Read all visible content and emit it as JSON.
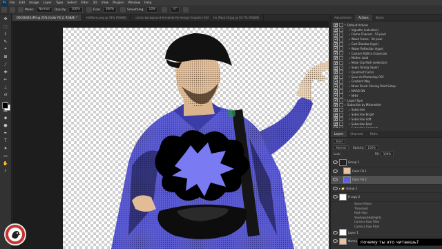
{
  "app": {
    "logo": "Ps"
  },
  "menu": [
    "File",
    "Edit",
    "Image",
    "Layer",
    "Type",
    "Select",
    "Filter",
    "3D",
    "View",
    "Plugins",
    "Window",
    "Help"
  ],
  "options_bar": {
    "mode_label": "Mode:",
    "mode_value": "Normal",
    "opacity_label": "Opacity:",
    "opacity_value": "100%",
    "flow_label": "Flow:",
    "flow_value": "100%",
    "smoothing_label": "Smoothing:",
    "smoothing_value": "10%",
    "angle_value": "0°"
  },
  "document_tabs": [
    {
      "label": "DSC06420.JPG @ 25% (Color Fill 2, RGB/8) *",
      "active": true
    },
    {
      "label": "Halftone.png @ 33% (RGB/8)",
      "active": false
    },
    {
      "label": "comic-background-template-for-design-Graphics-16477431-1.jpg @ 13,1%",
      "active": false
    },
    {
      "label": "lm_Mock.tif.jpg @ 16,7% (RGB/8)",
      "active": false
    }
  ],
  "toolbar_icons": [
    "move-icon",
    "marquee-icon",
    "lasso-icon",
    "quick-select-icon",
    "crop-icon",
    "frame-icon",
    "eyedropper-icon",
    "healing-icon",
    "brush-icon",
    "stamp-icon",
    "history-brush-icon",
    "eraser-icon",
    "gradient-icon",
    "blur-icon",
    "dodge-icon",
    "pen-icon",
    "type-icon",
    "path-select-icon",
    "shape-icon",
    "hand-icon",
    "zoom-icon"
  ],
  "colors": {
    "foreground": "#000000",
    "background": "#ffffff",
    "shirt": "#5c5cd6",
    "accent": "#31a8ff",
    "badge": "#c8322d"
  },
  "actions_panel": {
    "tabs": [
      "Adjustments",
      "Actions",
      "Styles"
    ],
    "items": [
      {
        "label": "Default Actions",
        "level": 0
      },
      {
        "label": "Vignette (selection)",
        "level": 1
      },
      {
        "label": "Frame Channel - 50 pixel",
        "level": 1
      },
      {
        "label": "Wood Frame - 50 pixel",
        "level": 1
      },
      {
        "label": "Cast Shadow (type)",
        "level": 1
      },
      {
        "label": "Water Reflection (type)",
        "level": 1
      },
      {
        "label": "Custom RGB to Grayscale",
        "level": 1
      },
      {
        "label": "Molten Lead",
        "level": 1
      },
      {
        "label": "Make Clip Path (selection)",
        "level": 1
      },
      {
        "label": "Sepia Toning (layer)",
        "level": 1
      },
      {
        "label": "Quadrant Colors",
        "level": 1
      },
      {
        "label": "Save As Photoshop PDF",
        "level": 1
      },
      {
        "label": "Gradient Map",
        "level": 1
      },
      {
        "label": "Mixer Brush Cloning Paint Setup",
        "level": 1
      },
      {
        "label": "MARD ON",
        "level": 1
      },
      {
        "label": "MHH",
        "level": 1
      },
      {
        "label": "Liquid Type",
        "level": 0
      },
      {
        "label": "Subscribe by Mikemelter",
        "level": 0
      },
      {
        "label": "Subscribe",
        "level": 1
      },
      {
        "label": "Subscribe Bright",
        "level": 1
      },
      {
        "label": "Subscribe Soft",
        "level": 1
      },
      {
        "label": "Subscribe Bold",
        "level": 1
      },
      {
        "label": "Subscribe Contrast",
        "level": 1
      }
    ]
  },
  "layers_panel": {
    "tabs": [
      "Layers",
      "Channels",
      "Paths"
    ],
    "kind_label": "Kind",
    "blend_mode": "Normal",
    "opacity_label": "Opacity:",
    "opacity_value": "100%",
    "lock_label": "Lock:",
    "fill_label": "Fill:",
    "fill_value": "100%",
    "layers": [
      {
        "name": "Group 2",
        "type": "group",
        "thumb": "mask",
        "selected": false
      },
      {
        "name": "Color Fill 1",
        "type": "fill",
        "thumb": "orange",
        "selected": false
      },
      {
        "name": "Color Fill 2",
        "type": "fill",
        "thumb": "blue",
        "selected": true
      },
      {
        "name": "Group 1",
        "type": "group",
        "thumb": "none",
        "selected": false
      },
      {
        "name": "K copy 2",
        "type": "smart",
        "thumb": "white",
        "selected": false
      }
    ],
    "smart_filters": [
      "Smart Filters",
      "Threshold",
      "High Pass",
      "Shadows/Highlights",
      "Camera Raw Filter",
      "Camera Raw Filter"
    ],
    "bottom_layers": [
      {
        "name": "Layer 1",
        "thumb": "white"
      },
      {
        "name": "Фотка",
        "thumb": "orange"
      }
    ]
  },
  "subtitle": "почему ты это читаешь?"
}
